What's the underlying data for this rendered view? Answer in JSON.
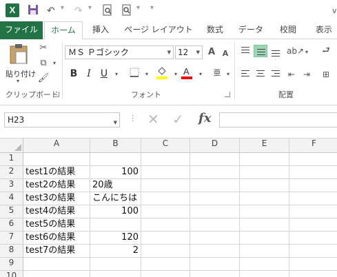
{
  "app": {
    "logo": "X",
    "undo_icon": "undo-icon",
    "redo_icon": "redo-icon"
  },
  "tabs": [
    {
      "label": "ファイル"
    },
    {
      "label": "ホーム"
    },
    {
      "label": "挿入"
    },
    {
      "label": "ページ レイアウト"
    },
    {
      "label": "数式"
    },
    {
      "label": "データ"
    },
    {
      "label": "校閲"
    },
    {
      "label": "表示"
    }
  ],
  "ribbon": {
    "paste_label": "貼り付け",
    "clipboard_label": "クリップボード",
    "font_group_label": "フォント",
    "align_group_label": "配置",
    "font_name": "ＭＳ Ｐゴシック",
    "font_size": "12",
    "bold": "B",
    "italic": "I",
    "underline": "U",
    "grow_font": "A",
    "shrink_font": "A",
    "font_color": "A",
    "phonetic": "亜",
    "accent_color": "#217346",
    "highlight_color": "#ffff00",
    "font_color_value": "#ff0000"
  },
  "formula_bar": {
    "name_box": "H23",
    "cancel": "✕",
    "enter": "✓",
    "fx": "fx",
    "formula": ""
  },
  "grid": {
    "columns": [
      "A",
      "B",
      "C",
      "D",
      "E",
      "F"
    ],
    "rows": [
      "1",
      "2",
      "3",
      "4",
      "5",
      "6",
      "7",
      "8",
      "9",
      "10"
    ],
    "cells": {
      "A2": "test1の結果",
      "B2": "100",
      "A3": "test2の結果",
      "B3": "20歳",
      "A4": "test3の結果",
      "B4": "こんにちは",
      "A5": "test4の結果",
      "B5": "100",
      "A6": "test5の結果",
      "A7": "test6の結果",
      "B7": "120",
      "A8": "test7の結果",
      "B8": "2"
    }
  }
}
